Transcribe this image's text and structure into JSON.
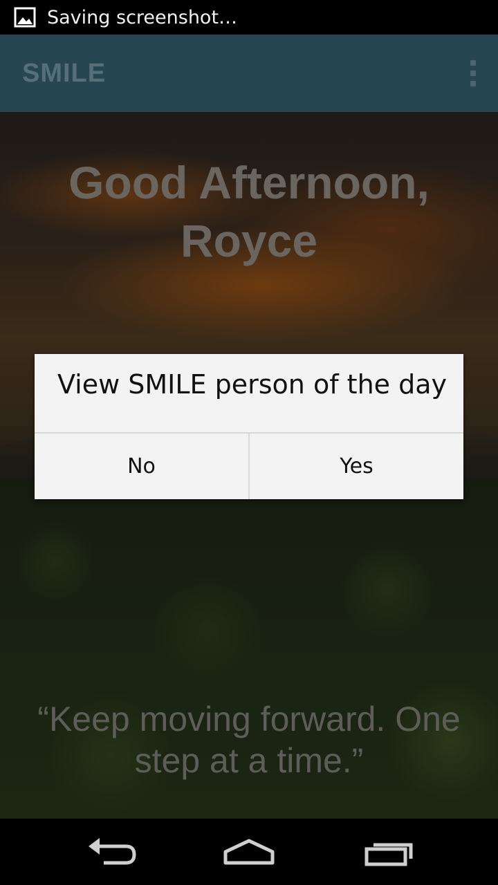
{
  "status_bar": {
    "text": "Saving screenshot…",
    "icon": "image-icon"
  },
  "action_bar": {
    "title": "SMILE",
    "overflow_icon": "overflow-menu-icon"
  },
  "content": {
    "greeting_line1": "Good Afternoon,",
    "greeting_line2": "Royce",
    "quote": "“Keep moving forward. One step at a time.”"
  },
  "dialog": {
    "message": "View SMILE person of the day",
    "negative_button": "No",
    "positive_button": "Yes"
  },
  "nav_bar": {
    "back_icon": "back-icon",
    "home_icon": "home-icon",
    "recents_icon": "recents-icon"
  },
  "colors": {
    "action_bar_bg": "#264652",
    "dialog_bg": "#f3f3f3"
  }
}
